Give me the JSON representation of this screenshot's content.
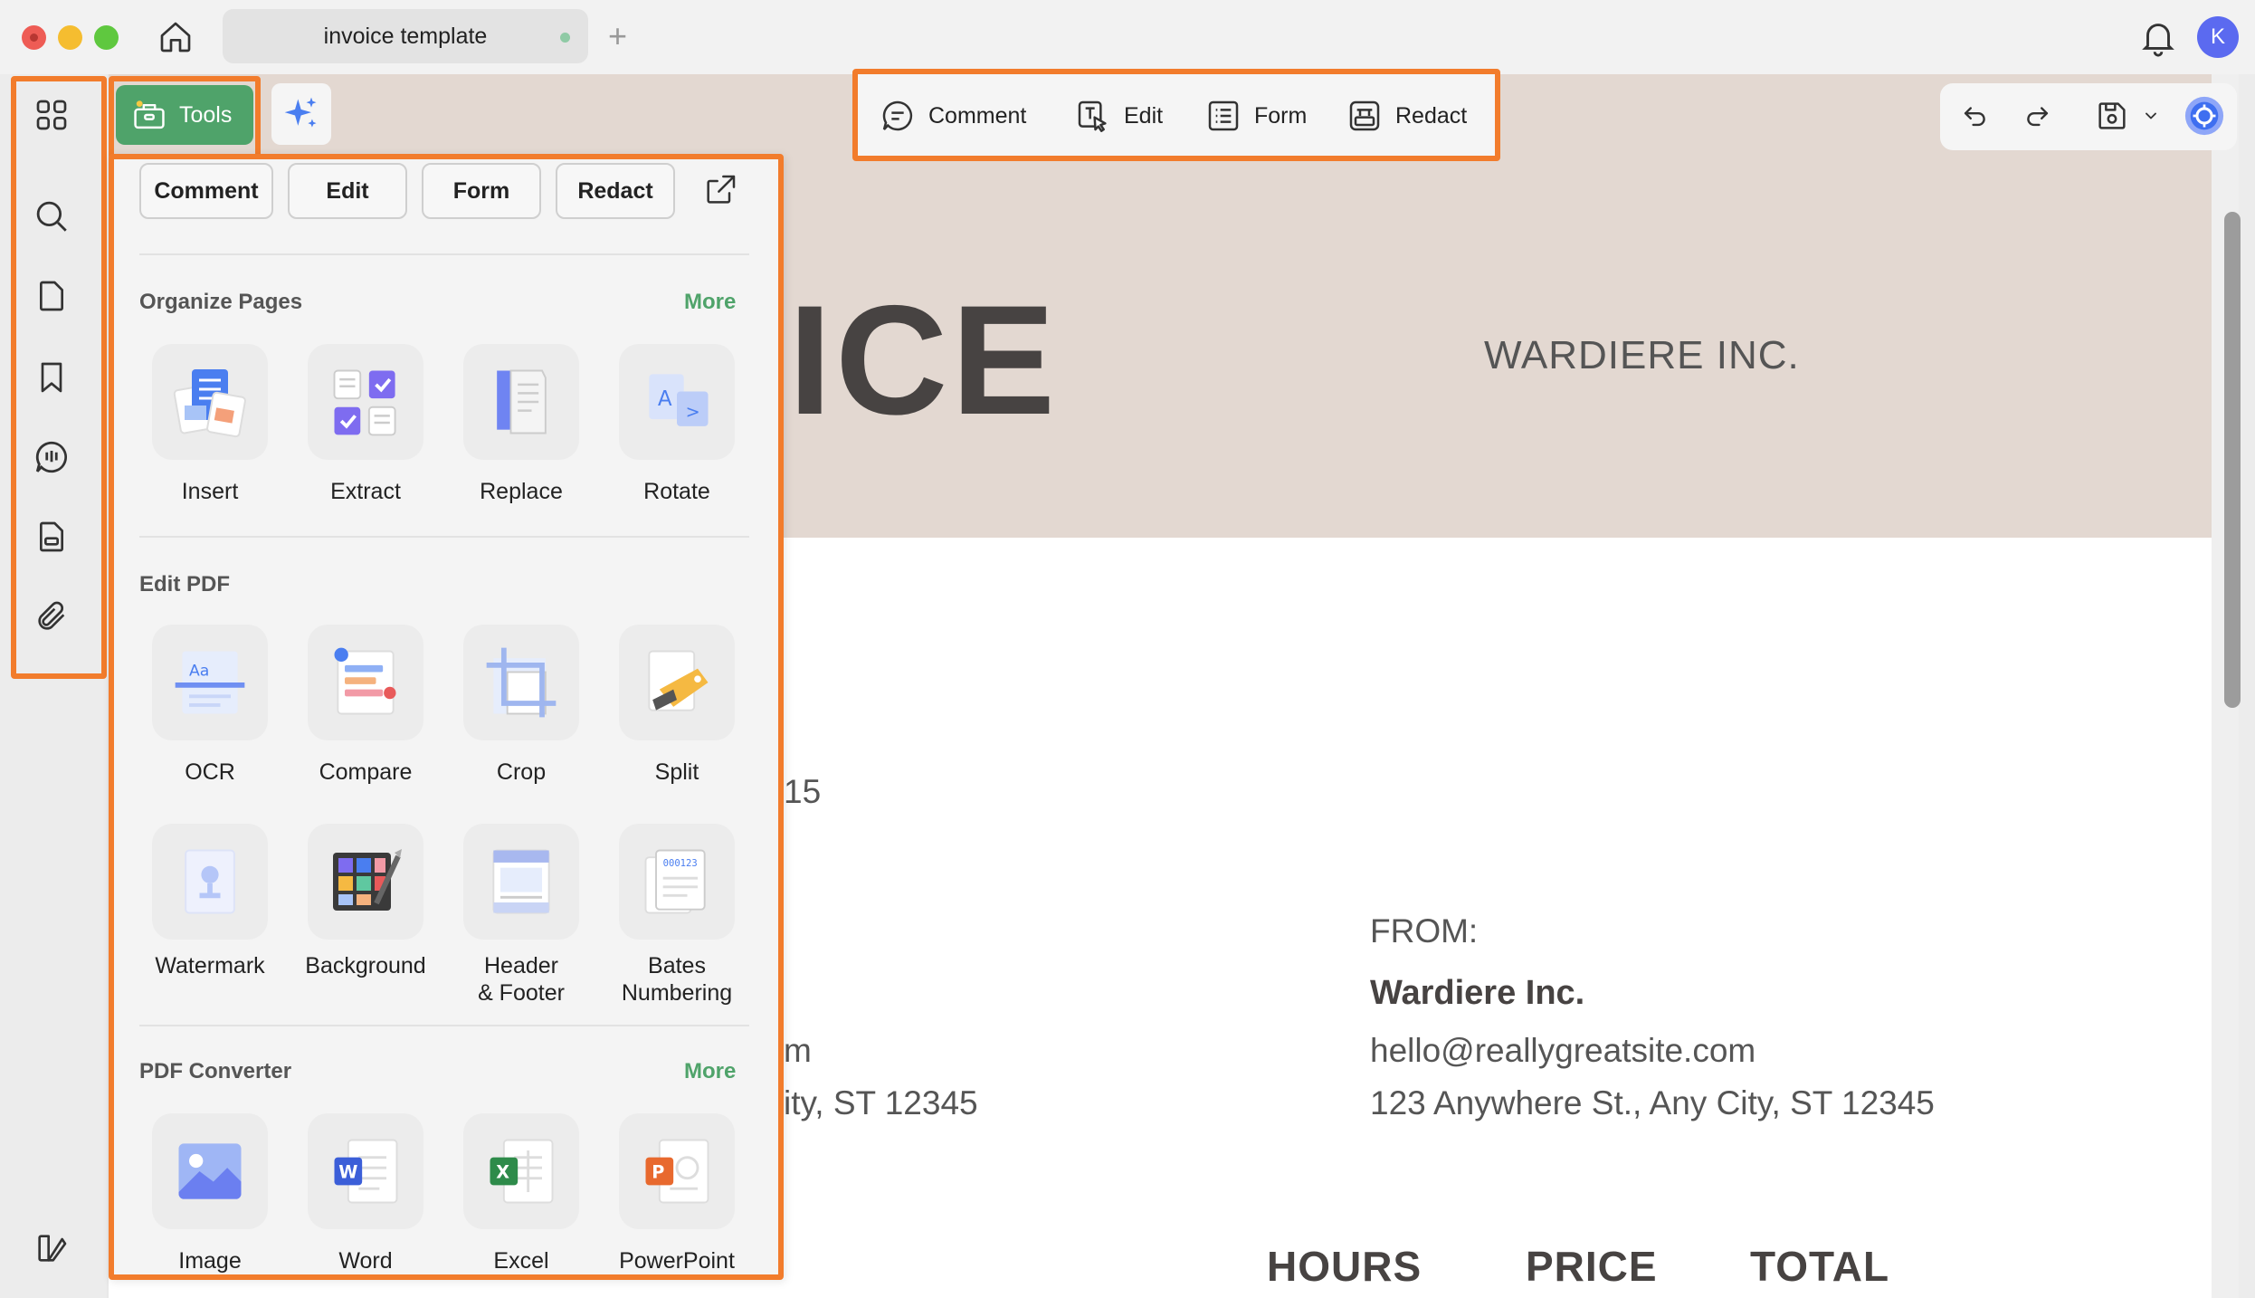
{
  "app": {
    "tab_title": "invoice template",
    "new_tab": "+",
    "avatar_initial": "K"
  },
  "tools_header": {
    "tools_label": "Tools"
  },
  "center_toolbar": {
    "items": [
      {
        "label": "Comment",
        "icon": "comment-icon"
      },
      {
        "label": "Edit",
        "icon": "edit-text-icon"
      },
      {
        "label": "Form",
        "icon": "form-icon"
      },
      {
        "label": "Redact",
        "icon": "redact-icon"
      }
    ]
  },
  "panel": {
    "chips": [
      "Comment",
      "Edit",
      "Form",
      "Redact"
    ],
    "sections": {
      "organize": {
        "title": "Organize Pages",
        "more": "More",
        "tools": [
          "Insert",
          "Extract",
          "Replace",
          "Rotate"
        ]
      },
      "edit_pdf": {
        "title": "Edit PDF",
        "tools": [
          "OCR",
          "Compare",
          "Crop",
          "Split",
          "Watermark",
          "Background",
          "Header\n& Footer",
          "Bates\nNumbering"
        ]
      },
      "converter": {
        "title": "PDF Converter",
        "more": "More",
        "tools": [
          "Image",
          "Word",
          "Excel",
          "PowerPoint"
        ]
      }
    }
  },
  "document": {
    "title_fragment": "ICE",
    "company": "WARDIERE INC.",
    "date_fragment": "15",
    "left_email_fragment": "m",
    "left_address_fragment": "ity, ST 12345",
    "from_label": "FROM:",
    "from_name": "Wardiere Inc.",
    "from_email": "hello@reallygreatsite.com",
    "from_address": "123 Anywhere St., Any City, ST 12345",
    "columns": [
      "HOURS",
      "PRICE",
      "TOTAL"
    ]
  },
  "colors": {
    "accent_orange": "#f27c2c",
    "tools_green": "#4fa36a",
    "header_band": "#e3d8d1",
    "avatar_blue": "#5b6af0"
  }
}
